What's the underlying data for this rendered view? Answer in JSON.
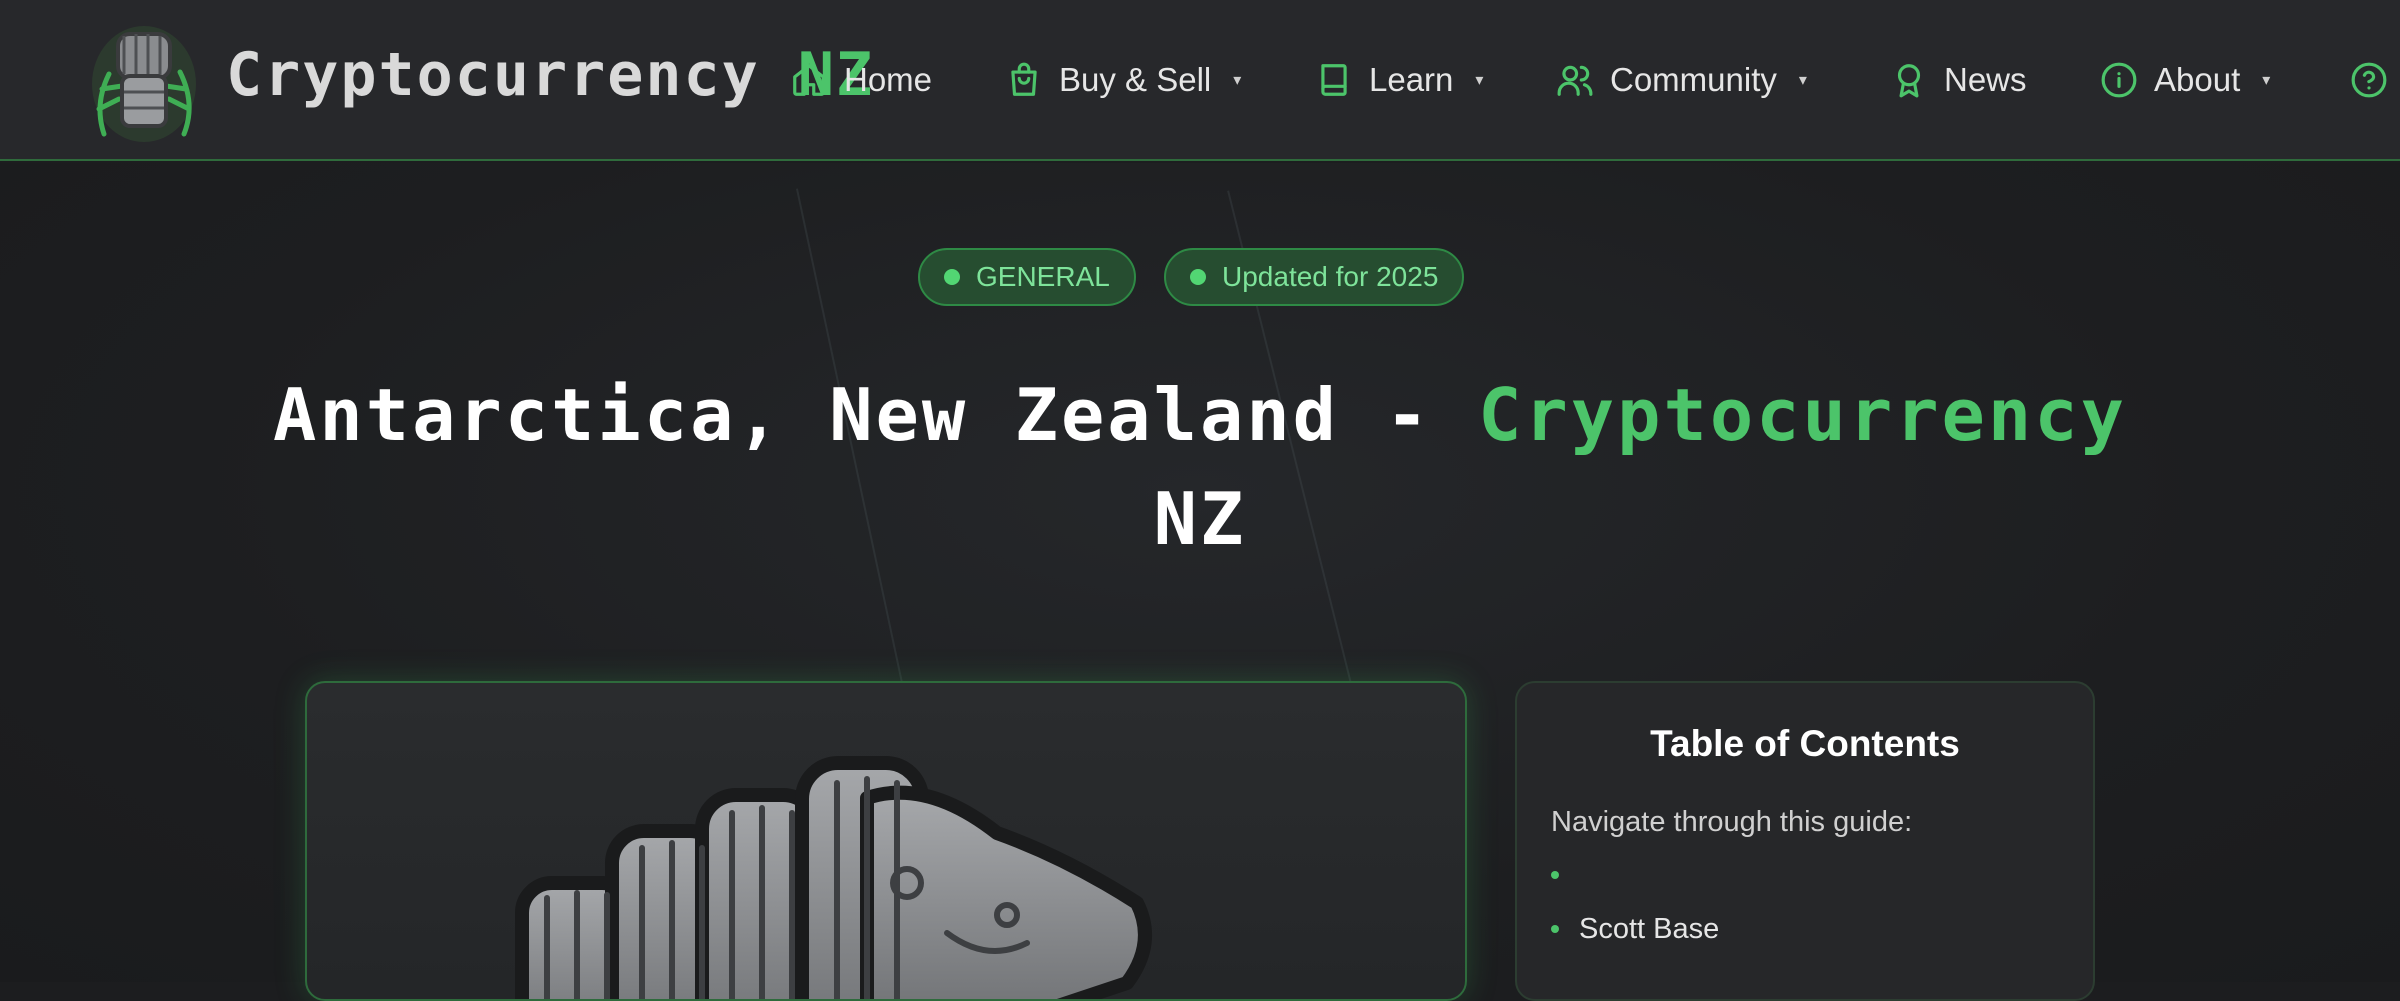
{
  "brand": {
    "name": "Cryptocurrency",
    "accent": "NZ",
    "logo_icon": "armored-fist-fern-logo"
  },
  "nav": {
    "items": [
      {
        "label": "Home",
        "icon": "home-icon",
        "dropdown": false
      },
      {
        "label": "Buy & Sell",
        "icon": "shopping-bag-icon",
        "dropdown": true
      },
      {
        "label": "Learn",
        "icon": "book-icon",
        "dropdown": true
      },
      {
        "label": "Community",
        "icon": "users-icon",
        "dropdown": true
      },
      {
        "label": "News",
        "icon": "award-icon",
        "dropdown": false
      },
      {
        "label": "About",
        "icon": "info-icon",
        "dropdown": true
      }
    ],
    "caret": "▾",
    "help_icon": "help-circle-icon"
  },
  "hero": {
    "badges": [
      {
        "label": "GENERAL"
      },
      {
        "label": "Updated for 2025"
      }
    ],
    "title_main": "Antarctica, New Zealand - ",
    "title_accent": "Cryptocurrency",
    "title_tail": "NZ"
  },
  "feature": {
    "image_icon": "armored-fist-illustration"
  },
  "toc": {
    "heading": "Table of Contents",
    "lead": "Navigate through this guide:",
    "items": [
      "",
      "Scott Base"
    ]
  },
  "colors": {
    "accent": "#4cc46a",
    "background": "#1c1d1f",
    "navbar": "#27282b",
    "badge_bg": "#264d30"
  }
}
